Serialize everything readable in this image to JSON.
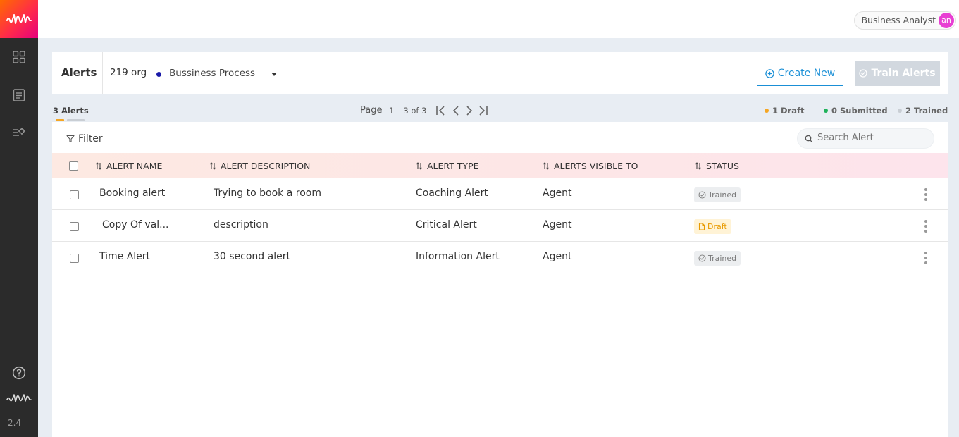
{
  "sidebar": {
    "version": "2.4"
  },
  "topbar": {
    "role": "Business Analyst",
    "avatar_initials": "an"
  },
  "header": {
    "title": "Alerts",
    "org": "219 org",
    "process": "Bussiness Process",
    "create_label": "Create New",
    "train_label": "Train Alerts"
  },
  "stats": {
    "count_label": "3 Alerts",
    "page_label": "Page",
    "page_range": "1 – 3 of 3",
    "legend": [
      {
        "label": "1 Draft",
        "color": "#f5a623"
      },
      {
        "label": "0 Submitted",
        "color": "#1fb25a"
      },
      {
        "label": "2 Trained",
        "color": "#c9ced4"
      }
    ]
  },
  "toolbar": {
    "filter_label": "Filter",
    "search_placeholder": "Search Alert"
  },
  "table": {
    "columns": [
      "ALERT NAME",
      "ALERT DESCRIPTION",
      "ALERT TYPE",
      "ALERTS VISIBLE TO",
      "STATUS"
    ],
    "rows": [
      {
        "name": "Booking alert",
        "description": "Trying to book a room",
        "type": "Coaching Alert",
        "visible_to": "Agent",
        "status": "Trained"
      },
      {
        "name": "Copy Of val...",
        "description": "description",
        "type": "Critical Alert",
        "visible_to": "Agent",
        "status": "Draft"
      },
      {
        "name": "Time Alert",
        "description": "30 second alert",
        "type": "Information Alert",
        "visible_to": "Agent",
        "status": "Trained"
      }
    ]
  }
}
